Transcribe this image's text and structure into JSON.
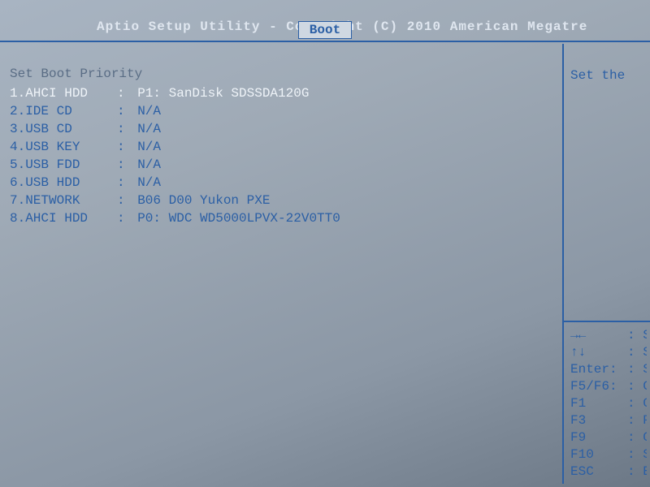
{
  "header": {
    "title": "Aptio Setup Utility - Copyright (C) 2010 American Megatre"
  },
  "tabs": {
    "active": "Boot"
  },
  "main": {
    "section_title": "Set Boot Priority",
    "boot_items": [
      {
        "label": "1.AHCI HDD",
        "value": "P1: SanDisk SDSSDA120G",
        "selected": true
      },
      {
        "label": "2.IDE CD",
        "value": "N/A",
        "selected": false
      },
      {
        "label": "3.USB CD",
        "value": "N/A",
        "selected": false
      },
      {
        "label": "4.USB KEY",
        "value": "N/A",
        "selected": false
      },
      {
        "label": "5.USB FDD",
        "value": "N/A",
        "selected": false
      },
      {
        "label": "6.USB HDD",
        "value": "N/A",
        "selected": false
      },
      {
        "label": "7.NETWORK",
        "value": "B06 D00 Yukon PXE",
        "selected": false
      },
      {
        "label": "8.AHCI HDD",
        "value": "P0: WDC WD5000LPVX-22V0TT0",
        "selected": false
      }
    ]
  },
  "side": {
    "help_text": "Set the",
    "keys": [
      {
        "key": "→←",
        "desc": "S"
      },
      {
        "key": "↑↓",
        "desc": "S"
      },
      {
        "key": "Enter:",
        "desc": "Se"
      },
      {
        "key": "F5/F6:",
        "desc": "Ch"
      },
      {
        "key": "F1",
        "desc": "Ge"
      },
      {
        "key": "F3",
        "desc": "Pr"
      },
      {
        "key": "F9",
        "desc": "Op"
      },
      {
        "key": "F10",
        "desc": "Sa"
      },
      {
        "key": "ESC",
        "desc": "Ex"
      }
    ]
  },
  "separator": ":"
}
